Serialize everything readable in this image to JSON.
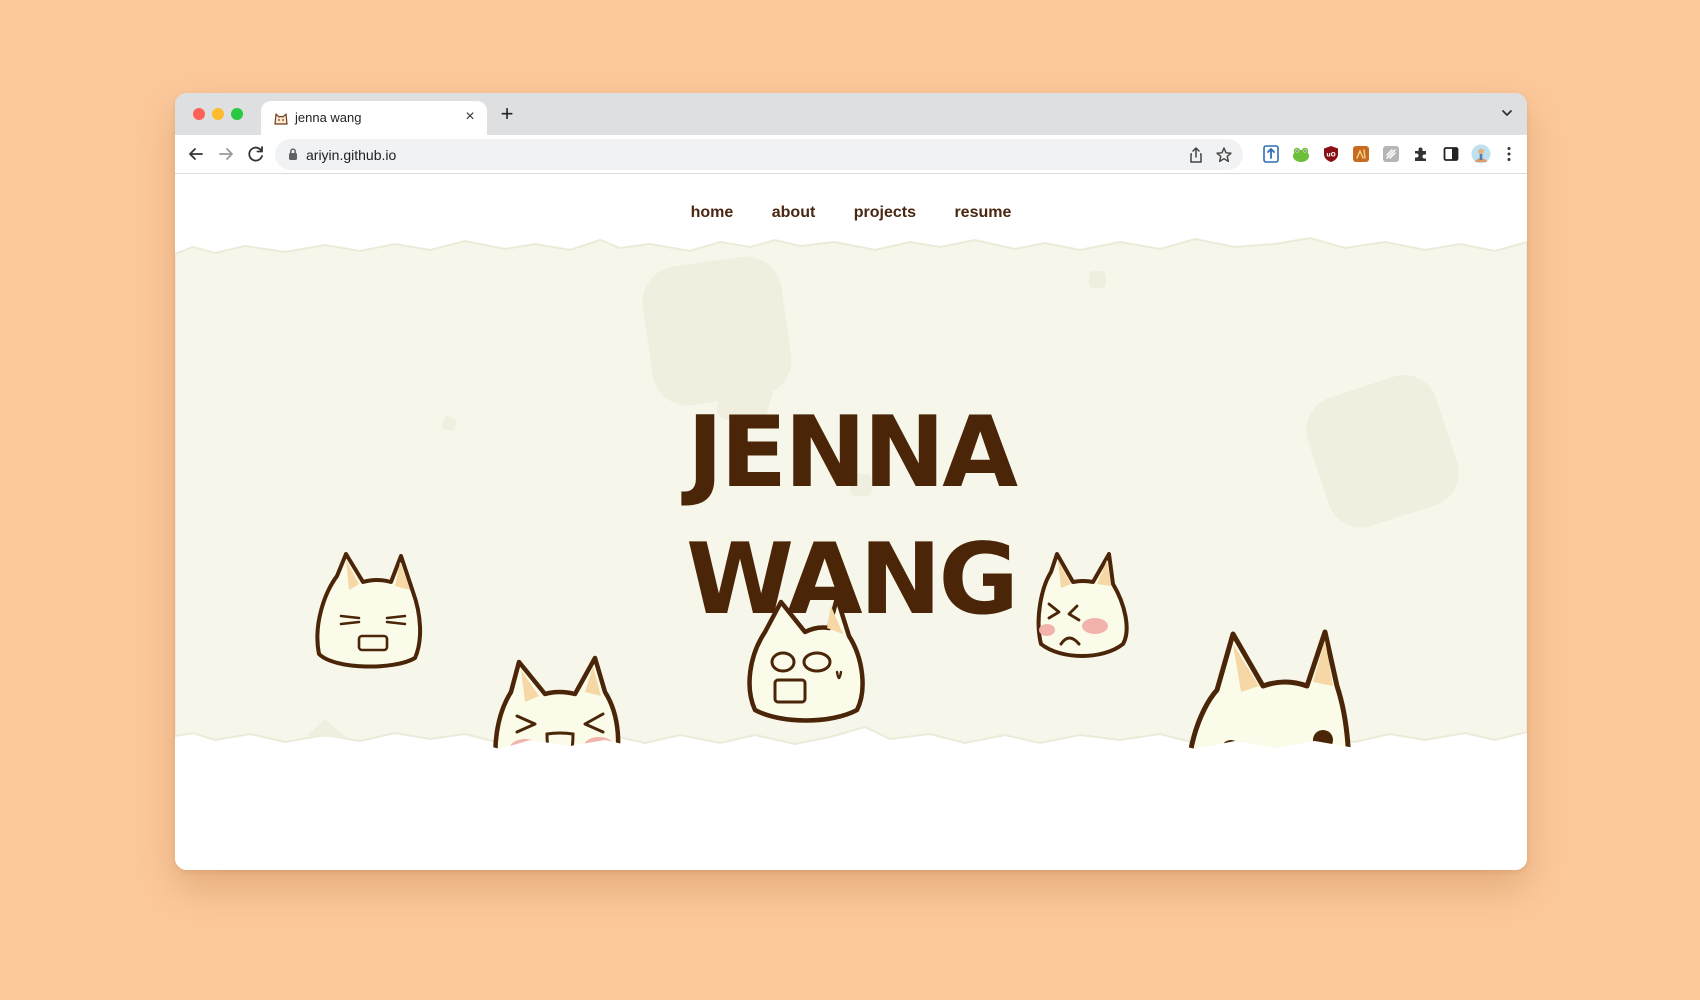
{
  "browser": {
    "tab": {
      "title": "jenna wang",
      "close": "×"
    },
    "new_tab": "+",
    "url": "ariyin.github.io",
    "icons": {
      "back": "arrow-left-icon",
      "forward": "arrow-right-icon",
      "reload": "reload-icon",
      "lock": "lock-icon",
      "share": "share-icon",
      "bookmark": "star-icon",
      "extensions": "puzzle-icon",
      "sidepanel": "side-panel-icon",
      "menu": "kebab-menu-icon",
      "tab_menu": "chevron-down-icon"
    },
    "extensions": [
      {
        "name": "extension-blue-icon",
        "color": "#2f6db5"
      },
      {
        "name": "extension-frog-icon",
        "color": "#6cbf3a"
      },
      {
        "name": "ublock-icon",
        "color": "#8b0f14"
      },
      {
        "name": "extension-orange-icon",
        "color": "#c76b1f"
      },
      {
        "name": "extension-gray-icon",
        "color": "#9a9a9a"
      }
    ]
  },
  "page": {
    "nav": [
      {
        "label": "home"
      },
      {
        "label": "about"
      },
      {
        "label": "projects"
      },
      {
        "label": "resume"
      }
    ],
    "hero": {
      "line1": "JENNA",
      "line2": "WANG"
    }
  },
  "colors": {
    "backdrop": "#fcc99c",
    "hero_bg": "#f7f6ea",
    "text_brown": "#4a2508",
    "cat_fill": "#fbfbea",
    "cat_ear": "#f6d7a6",
    "cat_blush": "#f2b3ad"
  }
}
